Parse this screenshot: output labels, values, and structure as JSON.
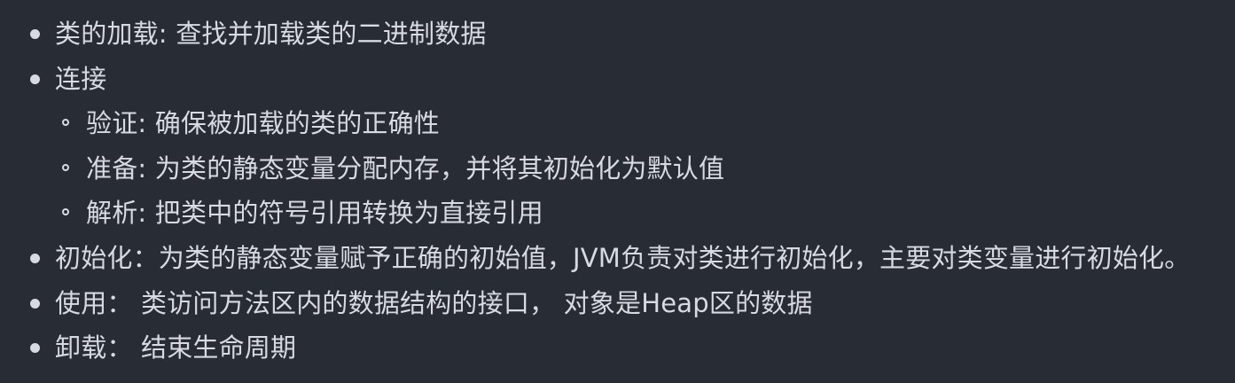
{
  "items": [
    {
      "text": "类的加载: 查找并加载类的二进制数据"
    },
    {
      "text": "连接",
      "children": [
        {
          "text": "验证: 确保被加载的类的正确性"
        },
        {
          "text": "准备: 为类的静态变量分配内存，并将其初始化为默认值"
        },
        {
          "text": "解析: 把类中的符号引用转换为直接引用"
        }
      ]
    },
    {
      "text": "初始化：为类的静态变量赋予正确的初始值，JVM负责对类进行初始化，主要对类变量进行初始化。"
    },
    {
      "text": "使用： 类访问方法区内的数据结构的接口， 对象是Heap区的数据"
    },
    {
      "text": "卸载： 结束生命周期"
    }
  ]
}
